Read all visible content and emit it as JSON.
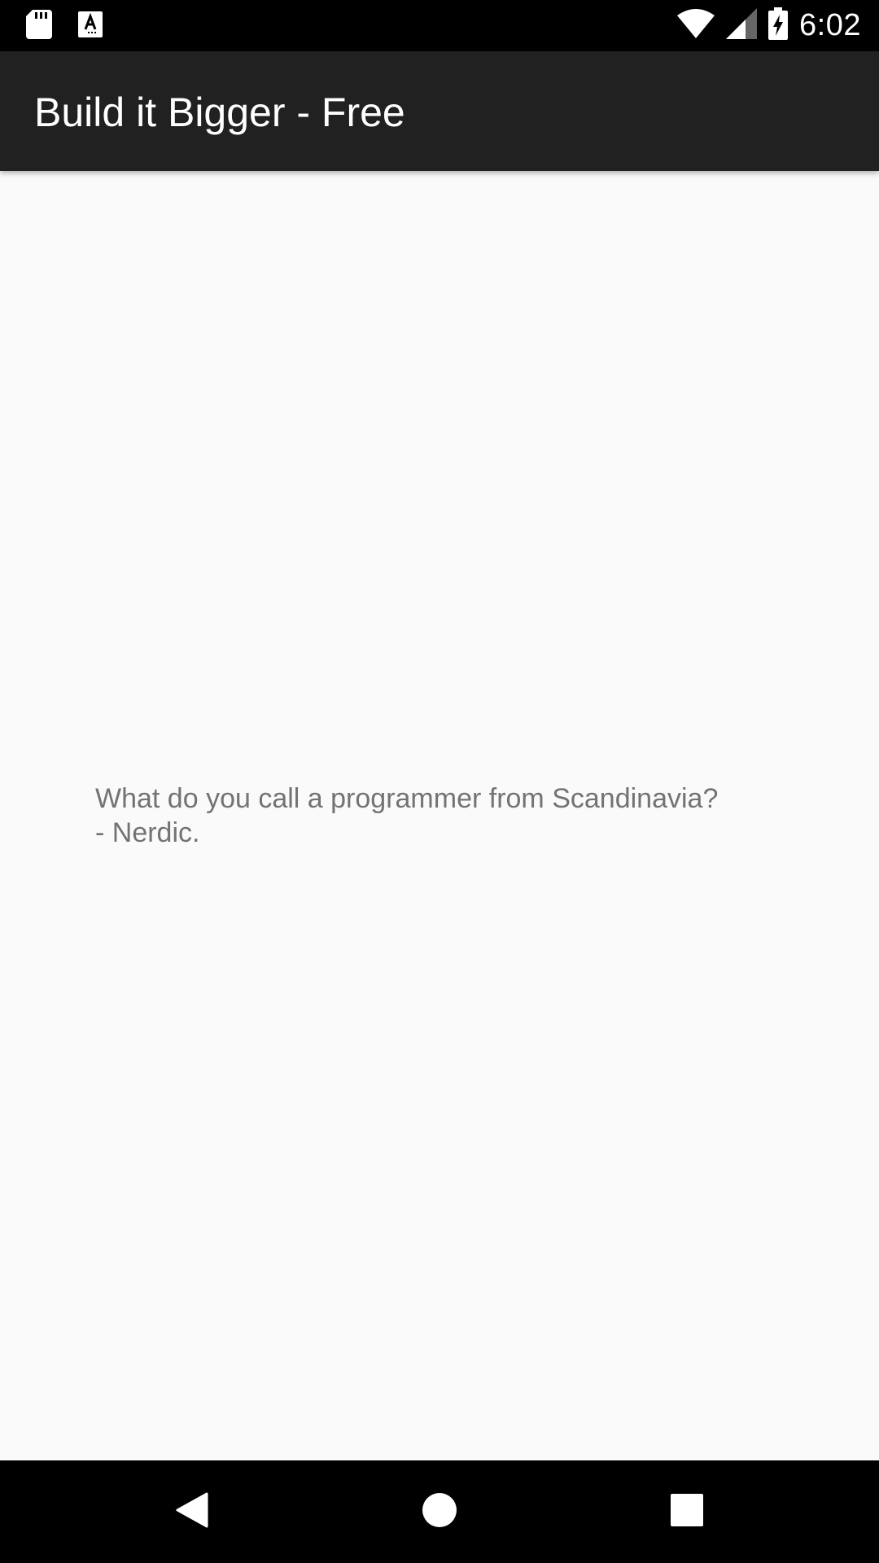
{
  "status_bar": {
    "time": "6:02",
    "icons_left": [
      "sd-card-icon",
      "text-a-icon"
    ],
    "icons_right": [
      "wifi-icon",
      "signal-icon",
      "battery-charging-icon"
    ]
  },
  "app_bar": {
    "title": "Build it Bigger - Free"
  },
  "content": {
    "joke_question": "What do you call a programmer from Scandinavia?",
    "joke_answer": "- Nerdic."
  },
  "nav_bar": {
    "buttons": [
      "back-icon",
      "home-icon",
      "recents-icon"
    ]
  },
  "colors": {
    "status_bar": "#000000",
    "app_bar": "#212121",
    "background": "#fafafa",
    "joke_text": "#737373",
    "nav_bar": "#000000"
  }
}
